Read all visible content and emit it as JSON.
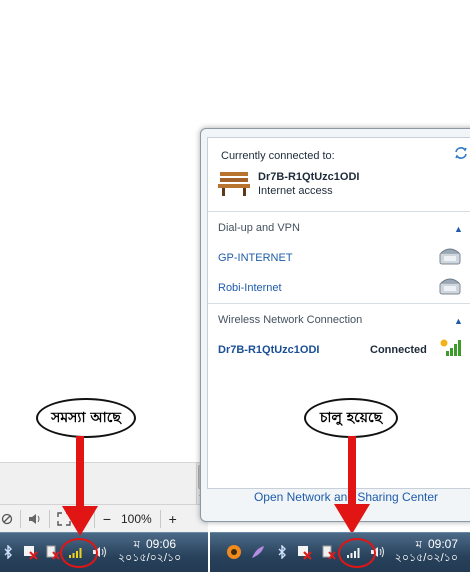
{
  "left": {
    "zoom_level": "100%",
    "zoom_minus": "−",
    "zoom_plus": "+",
    "clock": {
      "ampm": "ম",
      "time": "09:06",
      "date": "২০১৫/০২/১০"
    },
    "annotation": "সমস্যা আছে"
  },
  "right": {
    "clock": {
      "ampm": "ম",
      "time": "09:07",
      "date": "২০১৫/০২/১০"
    },
    "annotation": "চালু হয়েছে"
  },
  "popup": {
    "header": "Currently connected to:",
    "current_network": {
      "name": "Dr7B-R1QtUzc1ODI",
      "status": "Internet access"
    },
    "dialup_section": "Dial-up and VPN",
    "dialup_items": [
      {
        "label": "GP-INTERNET"
      },
      {
        "label": "Robi-Internet"
      }
    ],
    "wireless_section": "Wireless Network Connection",
    "wireless_item": {
      "name": "Dr7B-R1QtUzc1ODI",
      "status": "Connected"
    },
    "footer_link": "Open Network and Sharing Center"
  },
  "colors": {
    "arrow": "#e21515",
    "link": "#1e5ca8",
    "taskbar": "#29425c"
  },
  "icons": [
    "network-icon",
    "bench-icon",
    "modem-phone-icon",
    "signal-bars-icon",
    "volume-icon",
    "flag-icon",
    "bluetooth-icon",
    "power-icon",
    "refresh-icon"
  ]
}
